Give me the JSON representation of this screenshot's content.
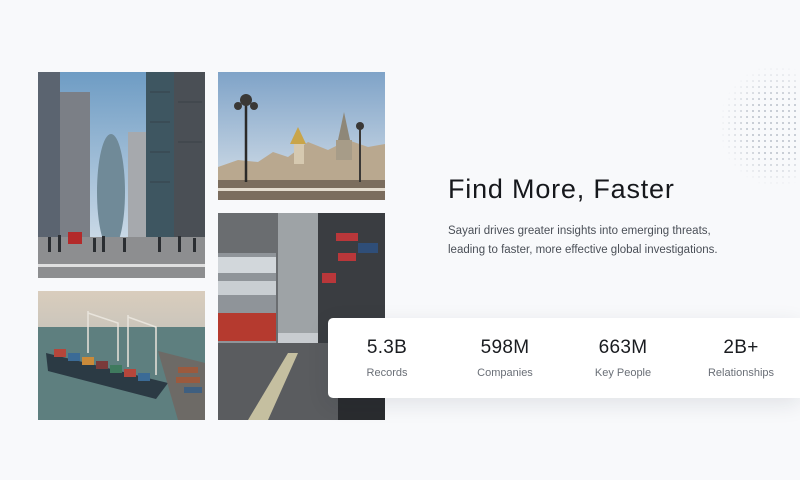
{
  "hero": {
    "title": "Find More, Faster",
    "description": "Sayari drives greater insights into emerging threats, leading to faster, more effective global investigations."
  },
  "gallery": [
    {
      "name": "london-street-photo"
    },
    {
      "name": "moscow-skyline-photo"
    },
    {
      "name": "cargo-port-photo"
    },
    {
      "name": "hong-kong-street-photo"
    }
  ],
  "stats": [
    {
      "value": "5.3B",
      "label": "Records"
    },
    {
      "value": "598M",
      "label": "Companies"
    },
    {
      "value": "663M",
      "label": "Key People"
    },
    {
      "value": "2B+",
      "label": "Relationships"
    }
  ]
}
